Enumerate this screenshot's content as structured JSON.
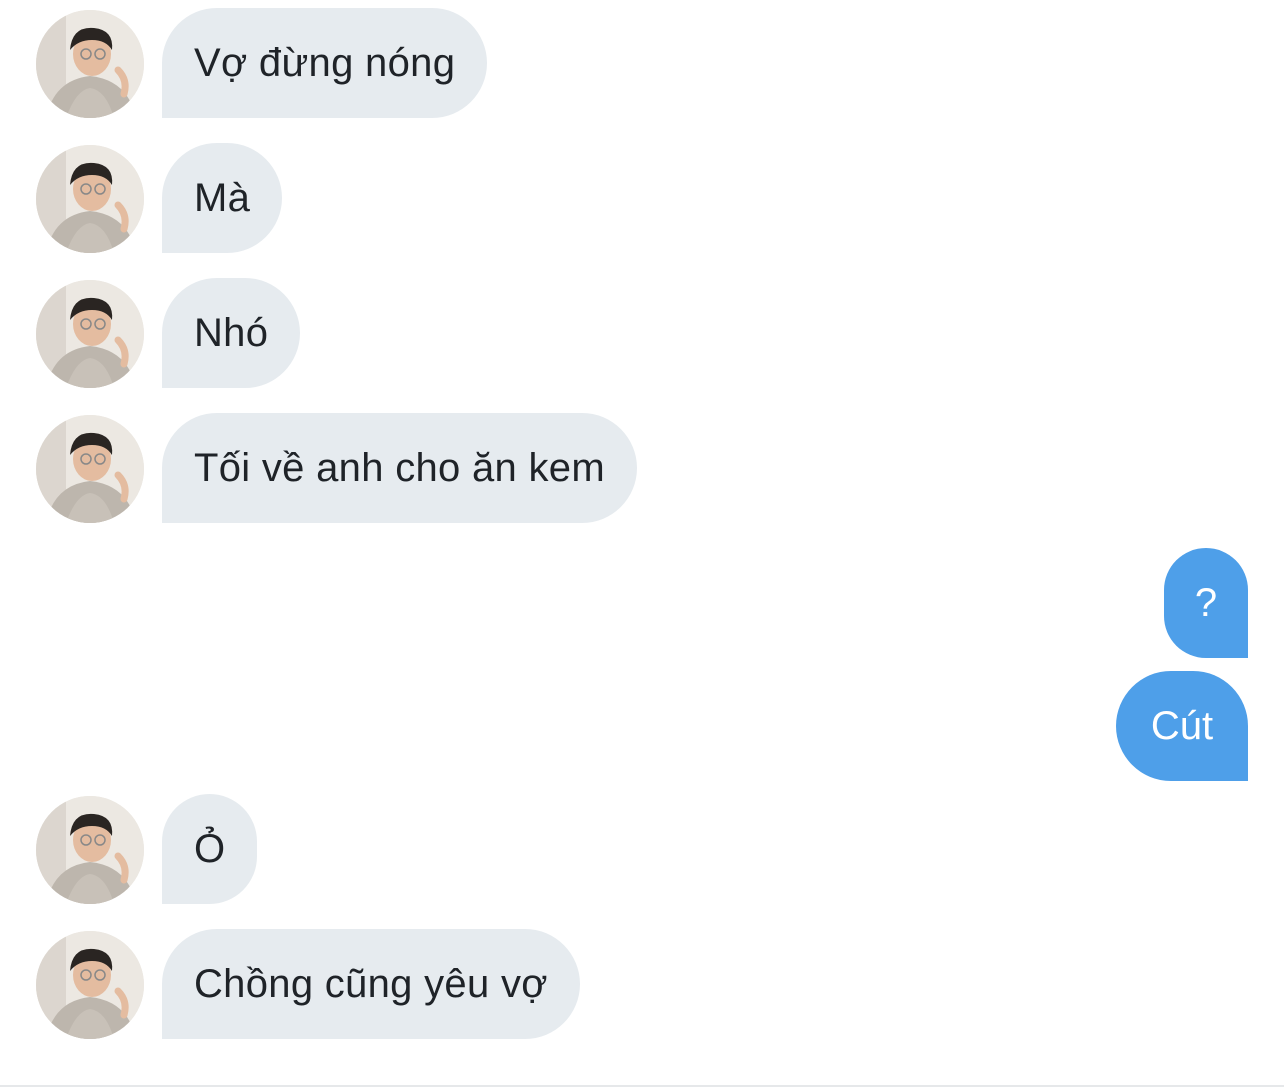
{
  "conversation": {
    "messages": [
      {
        "sender": "them",
        "text": "Vợ đừng nóng"
      },
      {
        "sender": "them",
        "text": "Mà"
      },
      {
        "sender": "them",
        "text": "Nhó"
      },
      {
        "sender": "them",
        "text": "Tối về anh cho ăn kem"
      },
      {
        "sender": "me",
        "text": "?"
      },
      {
        "sender": "me",
        "text": "Cút"
      },
      {
        "sender": "them",
        "text": "Ỏ"
      },
      {
        "sender": "them",
        "text": "Chồng cũng yêu vợ"
      }
    ]
  },
  "colors": {
    "incoming_bubble": "#e6ebef",
    "outgoing_bubble": "#4e9fe9",
    "incoming_text": "#1f2328",
    "outgoing_text": "#ffffff"
  },
  "icons": {
    "avatar": "profile-photo"
  }
}
